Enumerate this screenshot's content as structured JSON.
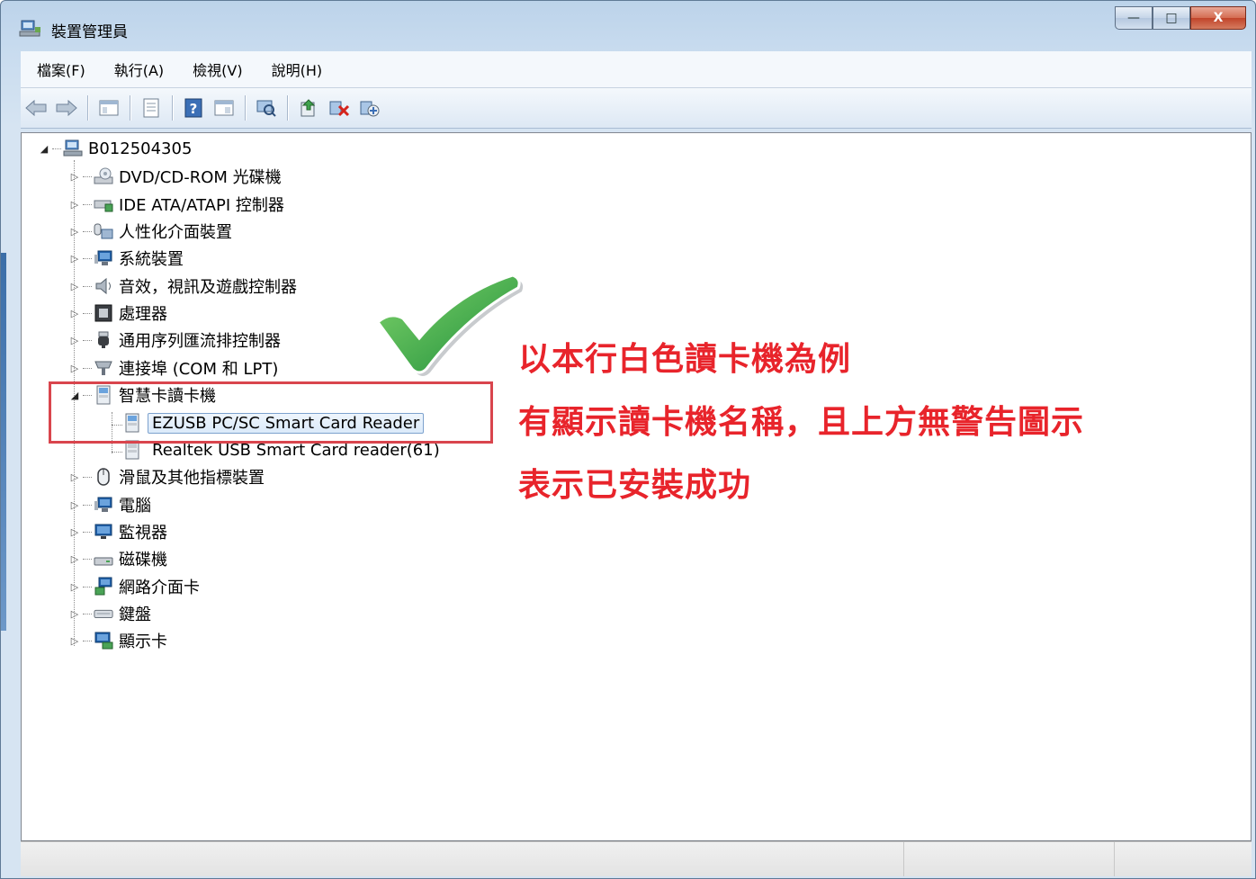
{
  "window": {
    "title": "裝置管理員",
    "controls": {
      "minimize": "—",
      "maximize": "□",
      "close": "X"
    }
  },
  "menu": [
    "檔案(F)",
    "執行(A)",
    "檢視(V)",
    "說明(H)"
  ],
  "toolbar": {
    "buttons": [
      "back-arrow-icon",
      "forward-arrow-icon",
      "show-hide-tree-icon",
      "properties-icon",
      "help-icon",
      "console-view-icon",
      "scan-hardware-icon",
      "update-driver-icon",
      "uninstall-device-icon",
      "enable-device-icon"
    ]
  },
  "tree": {
    "root": "B012504305",
    "categories": [
      {
        "label": "DVD/CD-ROM 光碟機",
        "icon": "dvd-drive-icon"
      },
      {
        "label": "IDE ATA/ATAPI 控制器",
        "icon": "ide-controller-icon"
      },
      {
        "label": "人性化介面裝置",
        "icon": "hid-device-icon"
      },
      {
        "label": "系統裝置",
        "icon": "system-device-icon"
      },
      {
        "label": "音效，視訊及遊戲控制器",
        "icon": "speaker-icon"
      },
      {
        "label": "處理器",
        "icon": "processor-icon"
      },
      {
        "label": "通用序列匯流排控制器",
        "icon": "usb-icon"
      },
      {
        "label": "連接埠 (COM 和 LPT)",
        "icon": "port-icon"
      },
      {
        "label": "智慧卡讀卡機",
        "icon": "smart-card-reader-icon",
        "expanded": true,
        "children": [
          {
            "label": "EZUSB PC/SC Smart Card Reader",
            "selected": true
          },
          {
            "label": "Realtek USB Smart Card reader(61)"
          }
        ]
      },
      {
        "label": "滑鼠及其他指標裝置",
        "icon": "mouse-icon"
      },
      {
        "label": "電腦",
        "icon": "computer-icon"
      },
      {
        "label": "監視器",
        "icon": "monitor-icon"
      },
      {
        "label": "磁碟機",
        "icon": "disk-drive-icon"
      },
      {
        "label": "網路介面卡",
        "icon": "network-adapter-icon"
      },
      {
        "label": "鍵盤",
        "icon": "keyboard-icon"
      },
      {
        "label": "顯示卡",
        "icon": "display-adapter-icon"
      }
    ]
  },
  "annotations": {
    "line1": "以本行白色讀卡機為例",
    "line2": "有顯示讀卡機名稱，且上方無警告圖示",
    "line3": "表示已安裝成功"
  },
  "colors": {
    "annotation": "#e8242b",
    "highlight_box": "#d9454d",
    "checkmark": "#2ea84a"
  }
}
